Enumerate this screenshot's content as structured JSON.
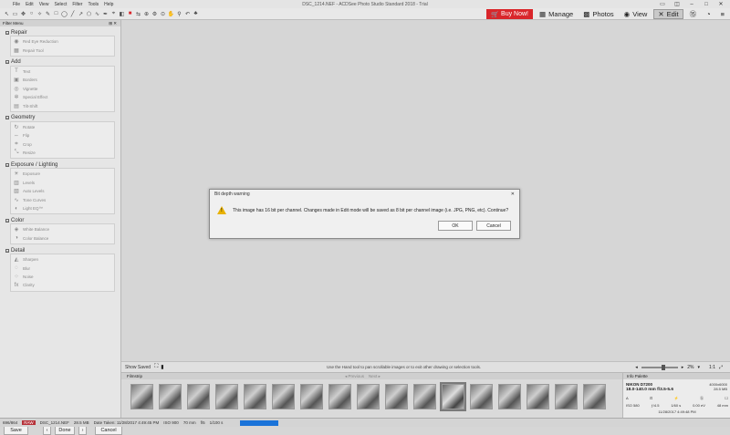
{
  "window": {
    "title": "DSC_1214.NEF - ACDSee Photo Studio Standard 2018 - Trial",
    "menu": [
      "File",
      "Edit",
      "View",
      "Select",
      "Filter",
      "Tools",
      "Help"
    ]
  },
  "modes": {
    "buy_now": "Buy Now!",
    "manage": "Manage",
    "photos": "Photos",
    "view": "View",
    "edit": "Edit"
  },
  "sidebar": {
    "title": "Filter Menu",
    "groups": [
      {
        "title": "Repair",
        "items": [
          {
            "icon": "eye-icon",
            "glyph": "◉",
            "label": "Red Eye Reduction"
          },
          {
            "icon": "bandage-icon",
            "glyph": "▦",
            "label": "Repair Tool"
          }
        ]
      },
      {
        "title": "Add",
        "items": [
          {
            "icon": "text-icon",
            "glyph": "T",
            "label": "Text"
          },
          {
            "icon": "borders-icon",
            "glyph": "▣",
            "label": "Borders"
          },
          {
            "icon": "vignette-icon",
            "glyph": "◎",
            "label": "Vignette"
          },
          {
            "icon": "special-effect-icon",
            "glyph": "✲",
            "label": "Special Effect"
          },
          {
            "icon": "tilt-shift-icon",
            "glyph": "▤",
            "label": "Tilt-Shift"
          }
        ]
      },
      {
        "title": "Geometry",
        "items": [
          {
            "icon": "rotate-icon",
            "glyph": "↻",
            "label": "Rotate"
          },
          {
            "icon": "flip-icon",
            "glyph": "⇔",
            "label": "Flip"
          },
          {
            "icon": "crop-icon",
            "glyph": "⌗",
            "label": "Crop"
          },
          {
            "icon": "resize-icon",
            "glyph": "⤡",
            "label": "Resize"
          }
        ]
      },
      {
        "title": "Exposure / Lighting",
        "items": [
          {
            "icon": "exposure-icon",
            "glyph": "☀",
            "label": "Exposure"
          },
          {
            "icon": "levels-icon",
            "glyph": "▥",
            "label": "Levels"
          },
          {
            "icon": "auto-levels-icon",
            "glyph": "▧",
            "label": "Auto Levels"
          },
          {
            "icon": "tone-curves-icon",
            "glyph": "∿",
            "label": "Tone Curves"
          },
          {
            "icon": "light-eq-icon",
            "glyph": "◐",
            "label": "Light EQ™"
          }
        ]
      },
      {
        "title": "Color",
        "items": [
          {
            "icon": "white-balance-icon",
            "glyph": "◈",
            "label": "White Balance"
          },
          {
            "icon": "color-balance-icon",
            "glyph": "◑",
            "label": "Color Balance"
          }
        ]
      },
      {
        "title": "Detail",
        "items": [
          {
            "icon": "sharpen-icon",
            "glyph": "◭",
            "label": "Sharpen"
          },
          {
            "icon": "blur-icon",
            "glyph": "◌",
            "label": "Blur"
          },
          {
            "icon": "noise-icon",
            "glyph": "⁘",
            "label": "Noise"
          },
          {
            "icon": "clarity-icon",
            "glyph": "fx",
            "label": "Clarity"
          }
        ]
      }
    ],
    "footer": {
      "save": "Save",
      "done": "Done",
      "cancel": "Cancel"
    }
  },
  "dialog": {
    "title": "Bit depth warning",
    "message": "This image has 16 bit per channel. Changes made in Edit mode will be saved as 8 bit per channel image (i.e. JPG, PNG, etc). Continue?",
    "ok": "OK",
    "cancel": "Cancel"
  },
  "status": {
    "show_saved": "Show Saved",
    "hint": "Use the Hand tool to pan scrollable images or to exit other drawing or selection tools.",
    "zoom": "2%",
    "ratio": "1:1"
  },
  "filmstrip": {
    "title": "Filmstrip",
    "previous": "Previous",
    "next": "Next",
    "count": 17,
    "selected_index": 11
  },
  "info_palette": {
    "title": "Info Palette",
    "camera": "NIKON D7200",
    "lens": "18.0-140.0 mm f/3.5-5.6",
    "resolution": "4000x6000",
    "size": "28.5 MB",
    "iso": "ISO 580",
    "aperture": "ƒ/4.5",
    "shutter": "1/60 s",
    "ev": "0.00 eV",
    "focal": "48 mm",
    "date": "11/28/2017 4:49:48 PM"
  },
  "bottom": {
    "position": "696/864",
    "badge": "RAW",
    "filename": "DSC_1214.NEF",
    "filesize": "28.5 MB",
    "date_taken": "Date Taken: 11/28/2017 4:49:45 PM",
    "iso": "ISO 900",
    "focal": "70 mm",
    "aperture": "f/5",
    "shutter": "1/100 s"
  }
}
